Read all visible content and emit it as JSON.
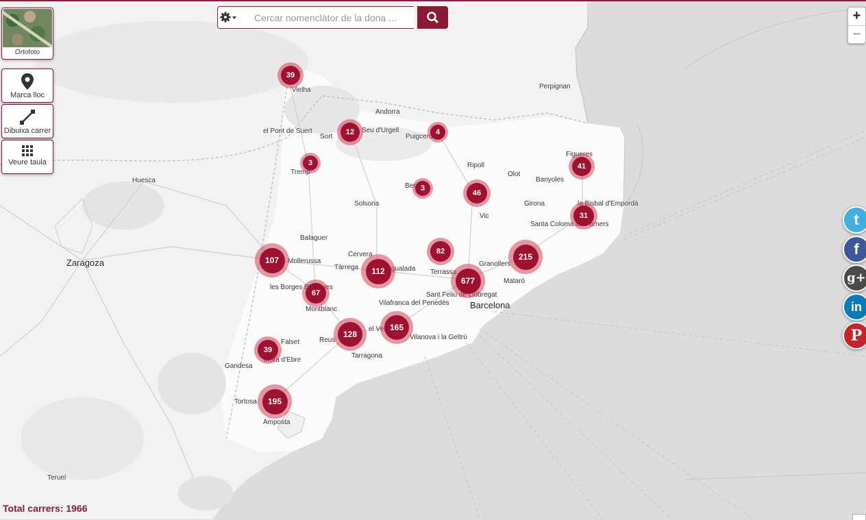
{
  "search": {
    "placeholder": "Cercar nomenclàtor de la dona ..."
  },
  "controls": {
    "ortho_label": "Ortofoto",
    "marca_label": "Marca lloc",
    "dibuixa_label": "Dibuixa carrer",
    "taula_label": "Veure taula"
  },
  "zoom": {
    "in": "+",
    "out": "−"
  },
  "total_text": "Total carrers: 1966",
  "clusters": [
    {
      "label": "39"
    },
    {
      "label": "12"
    },
    {
      "label": "4"
    },
    {
      "label": "3"
    },
    {
      "label": "3"
    },
    {
      "label": "41"
    },
    {
      "label": "46"
    },
    {
      "label": "31"
    },
    {
      "label": "107"
    },
    {
      "label": "82"
    },
    {
      "label": "112"
    },
    {
      "label": "215"
    },
    {
      "label": "677"
    },
    {
      "label": "67"
    },
    {
      "label": "128"
    },
    {
      "label": "165"
    },
    {
      "label": "39"
    },
    {
      "label": "195"
    }
  ],
  "places": [
    "Vielha",
    "Andorra",
    "el Pont de Suert",
    "Sort",
    "Seu d'Urgell",
    "Puigcerdà",
    "Tremp",
    "Ripoll",
    "Olot",
    "Figueres",
    "Banyoles",
    "Berga",
    "Solsona",
    "Huesca",
    "Girona",
    "la Bisbal d'Empordà",
    "Vic",
    "Santa Coloma de Farners",
    "Balaguer",
    "Cervera",
    "Zaragoza",
    "Mollerussa",
    "Tàrrega",
    "Igualada",
    "Granollers",
    "Terrassa",
    "Mataró",
    "Sant Feliu de Llobregat",
    "Barcelona",
    "les Borges Blanques",
    "Vilafranca del Penedès",
    "Montblanc",
    "Reus",
    "el Vendrell",
    "Vilanova i la Geltrú",
    "Falset",
    "Tarragona",
    "Móra d'Ebre",
    "Gandesa",
    "Tortosa",
    "Amposta",
    "Teruel",
    "Perpignan"
  ],
  "colors": {
    "accent": "#8c1a35",
    "cluster": "#9e1131",
    "sea": "#dcdcdc",
    "land": "#f7f7f7"
  },
  "icons": {
    "settings": "gear-icon",
    "search": "search-icon",
    "marca": "map-marker-icon",
    "dibuixa": "line-draw-icon",
    "taula": "grid-icon"
  }
}
